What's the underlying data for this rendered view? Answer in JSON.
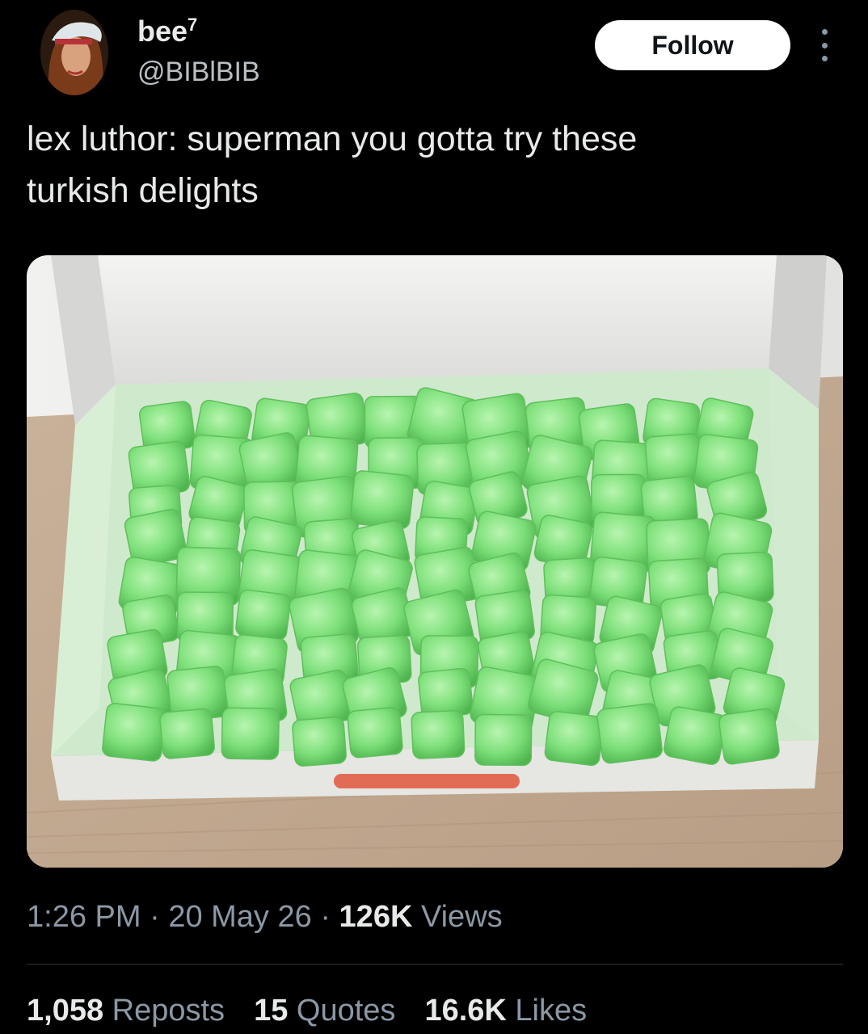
{
  "user": {
    "display_name": "bee",
    "display_name_sup": "7",
    "handle": "@BIBlBIB"
  },
  "follow_label": "Follow",
  "tweet_text": "lex luthor: superman you gotta try these\nturkish delights",
  "meta": {
    "time": "1:26 PM",
    "date": "20 May 26",
    "views_count": "126K",
    "views_label": "Views"
  },
  "stats": {
    "reposts_count": "1,058",
    "reposts_label": "Reposts",
    "quotes_count": "15",
    "quotes_label": "Quotes",
    "likes_count": "16.6K",
    "likes_label": "Likes"
  },
  "colors": {
    "background": "#000000",
    "text": "#e7e9ea",
    "muted": "#8b98a5",
    "candy_green": "#7ee07a"
  }
}
